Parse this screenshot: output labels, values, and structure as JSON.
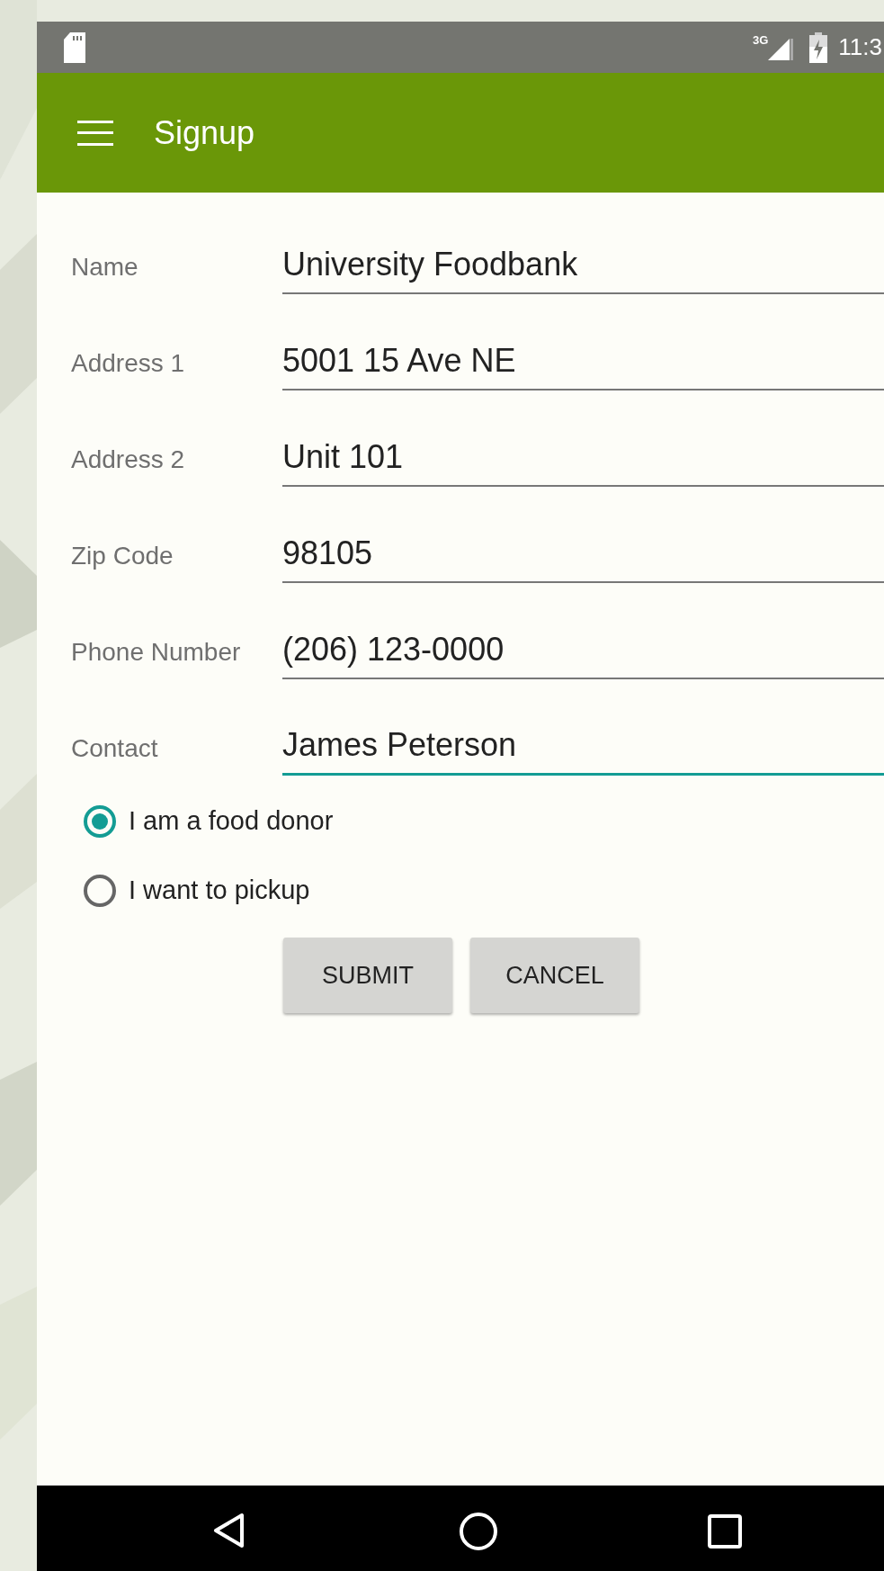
{
  "status_bar": {
    "network": "3G",
    "time": "11:3"
  },
  "toolbar": {
    "title": "Signup"
  },
  "fields": [
    {
      "label": "Name",
      "value": "University Foodbank",
      "focused": false
    },
    {
      "label": "Address 1",
      "value": "5001 15 Ave NE",
      "focused": false
    },
    {
      "label": "Address 2",
      "value": "Unit 101",
      "focused": false
    },
    {
      "label": "Zip Code",
      "value": "98105",
      "focused": false
    },
    {
      "label": "Phone Number",
      "value": "(206) 123-0000",
      "focused": false
    },
    {
      "label": "Contact",
      "value": "James Peterson",
      "focused": true
    }
  ],
  "options": [
    {
      "label": "I am a food donor",
      "selected": true
    },
    {
      "label": "I want to pickup",
      "selected": false
    }
  ],
  "buttons": [
    "SUBMIT",
    "CANCEL"
  ]
}
